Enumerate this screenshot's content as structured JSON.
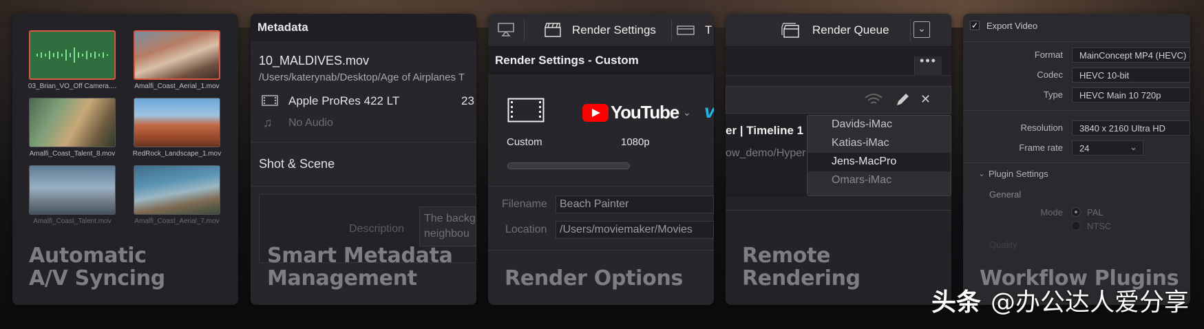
{
  "cards": {
    "sync": {
      "title_line1": "Automatic",
      "title_line2": "A/V Syncing",
      "thumbs": [
        {
          "label": "03_Brian_VO_Off Camera...."
        },
        {
          "label": "Amalfi_Coast_Aerial_1.mov"
        },
        {
          "label": "Amalfi_Coast_Talent_8.mov"
        },
        {
          "label": "RedRock_Landscape_1.mov"
        },
        {
          "label": "Amalfi_Coast_Talent.mov"
        },
        {
          "label": "Amalfi_Coast_Aerial_7.mov"
        }
      ]
    },
    "metadata": {
      "header": "Metadata",
      "filename": "10_MALDIVES.mov",
      "path": "/Users/katerynab/Desktop/Age of Airplanes T",
      "codec": "Apple ProRes 422 LT",
      "codec_extra": "23",
      "audio": "No Audio",
      "section": "Shot & Scene",
      "desc_label": "Description",
      "desc_text_1": "The backg",
      "desc_text_2": "neighbou",
      "title_line1": "Smart Metadata",
      "title_line2": "Management"
    },
    "render": {
      "tab_render_settings": "Render Settings",
      "tab_next": "T",
      "panel_title": "Render Settings - Custom",
      "preset_custom": "Custom",
      "preset_youtube": "YouTube",
      "preset_resolution": "1080p",
      "filename_label": "Filename",
      "filename_value": "Beach Painter",
      "location_label": "Location",
      "location_value": "/Users/moviemaker/Movies",
      "title": "Render Options"
    },
    "remote": {
      "queue_title": "Render Queue",
      "job_title": "er | Timeline 1",
      "job_path": "ow_demo/Hyper",
      "machines": [
        "Davids-iMac",
        "Katias-iMac",
        "Jens-MacPro",
        "Omars-iMac"
      ],
      "title_line1": "Remote",
      "title_line2": "Rendering"
    },
    "plugins": {
      "export_video": "Export Video",
      "format_label": "Format",
      "format_value": "MainConcept MP4 (HEVC)",
      "codec_label": "Codec",
      "codec_value": "HEVC 10-bit",
      "type_label": "Type",
      "type_value": "HEVC Main 10 720p",
      "resolution_label": "Resolution",
      "resolution_value": "3840 x 2160 Ultra HD",
      "framerate_label": "Frame rate",
      "framerate_value": "24",
      "plugin_settings": "Plugin Settings",
      "general": "General",
      "mode_label": "Mode",
      "mode_pal": "PAL",
      "mode_ntsc": "NTSC",
      "quality_label": "Quality",
      "title": "Workflow Plugins"
    }
  },
  "watermark": {
    "brand": "头条",
    "handle": "@办公达人爱分享"
  },
  "colors": {
    "selection": "#e0553f",
    "youtube_red": "#ff0000",
    "vimeo_blue": "#1ab7ea"
  }
}
